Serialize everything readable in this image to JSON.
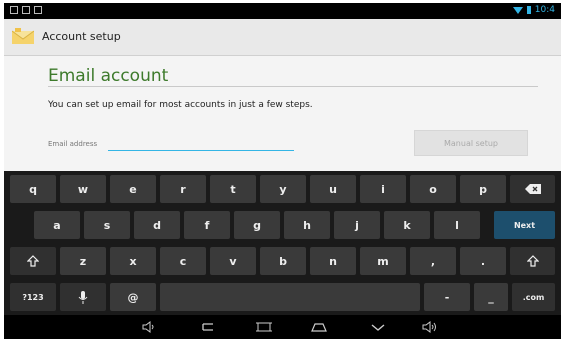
{
  "status_bar": {
    "time": "10:4"
  },
  "action_bar": {
    "title": "Account setup"
  },
  "form": {
    "heading": "Email account",
    "intro": "You can set up email for most accounts in just a few steps.",
    "email_label": "Email address",
    "email_value": "",
    "manual_setup_label": "Manual setup"
  },
  "keyboard": {
    "row1": [
      "q",
      "w",
      "e",
      "r",
      "t",
      "y",
      "u",
      "i",
      "o",
      "p"
    ],
    "row2": [
      "a",
      "s",
      "d",
      "f",
      "g",
      "h",
      "j",
      "k",
      "l"
    ],
    "row3": [
      "z",
      "x",
      "c",
      "v",
      "b",
      "n",
      "m",
      ",",
      "."
    ],
    "next_label": "Next",
    "symbols_label": "?123",
    "at_label": "@",
    "dash_label": "-",
    "underscore_label": "_",
    "com_label": ".com"
  },
  "colors": {
    "accent": "#33b5e5",
    "heading": "#3d7a2b",
    "next_key": "#1d4f6d"
  }
}
